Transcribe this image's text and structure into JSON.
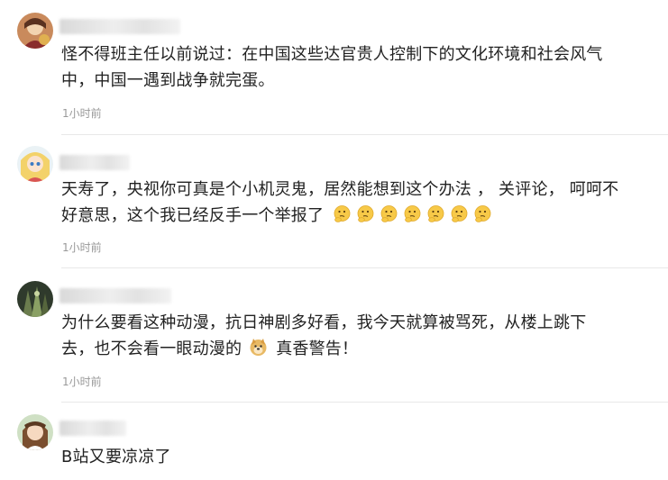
{
  "comments": [
    {
      "text_lines": [
        "怪不得班主任以前说过：在中国这些达官贵人控制下的文化环境和社会风气",
        "中，中国一遇到战争就完蛋。"
      ],
      "time": "1小时前"
    },
    {
      "text_lines": [
        "天寿了，央视你可真是个小机灵鬼，居然能想到这个办法 ， 关评论， 呵呵不",
        "好意思，这个我已经反手一个举报了"
      ],
      "emoji_icon": "thinking-face-emoji",
      "time": "1小时前"
    },
    {
      "text_lines": [
        "为什么要看这种动漫，抗日神剧多好看，我今天就算被骂死，从楼上跳下",
        "去，也不会看一眼动漫的"
      ],
      "line2_suffix": "真香警告！",
      "emoji_icon": "doge-emoji",
      "time": "1小时前"
    },
    {
      "text_lines": [
        "B站又要凉凉了"
      ]
    }
  ],
  "colors": {
    "text": "#222222",
    "time": "#999999",
    "divider": "#e8e8e8",
    "emoji_yellow": "#f7c948"
  }
}
